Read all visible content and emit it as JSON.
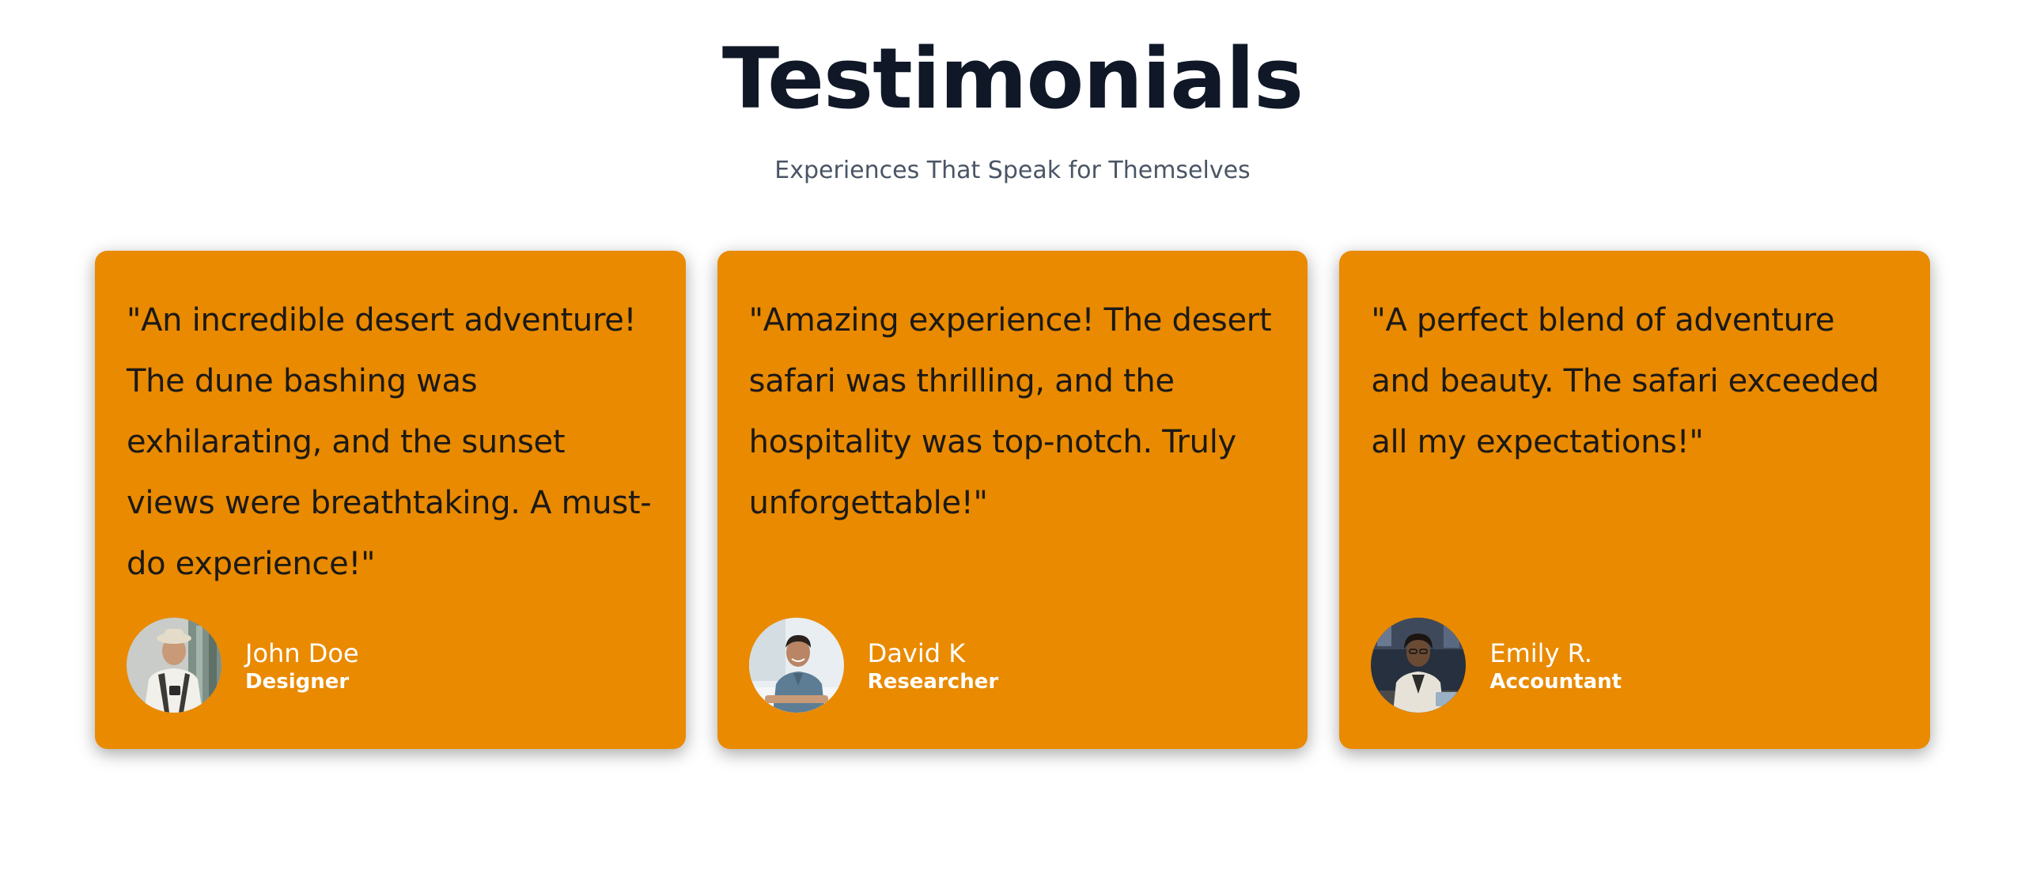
{
  "header": {
    "title": "Testimonials",
    "subtitle": "Experiences That Speak for Themselves"
  },
  "theme": {
    "card_color": "#e98a00",
    "title_color": "#101828",
    "subtitle_color": "#4a5565",
    "quote_color": "#1c1917",
    "author_color": "#ffffff"
  },
  "testimonials": [
    {
      "quote": "\"An incredible desert adventure! The dune bashing was exhilarating, and the sunset views were breathtaking. A must-do experience!\"",
      "name": "John Doe",
      "role": "Designer",
      "avatar_icon": "avatar-photo-man-backpack"
    },
    {
      "quote": "\"Amazing experience! The desert safari was thrilling, and the hospitality was top-notch. Truly unforgettable!\"",
      "name": "David K",
      "role": "Researcher",
      "avatar_icon": "avatar-photo-man-desk"
    },
    {
      "quote": "\"A perfect blend of adventure and beauty. The safari exceeded all my expectations!\"",
      "name": "Emily R.",
      "role": "Accountant",
      "avatar_icon": "avatar-photo-woman-office"
    }
  ]
}
